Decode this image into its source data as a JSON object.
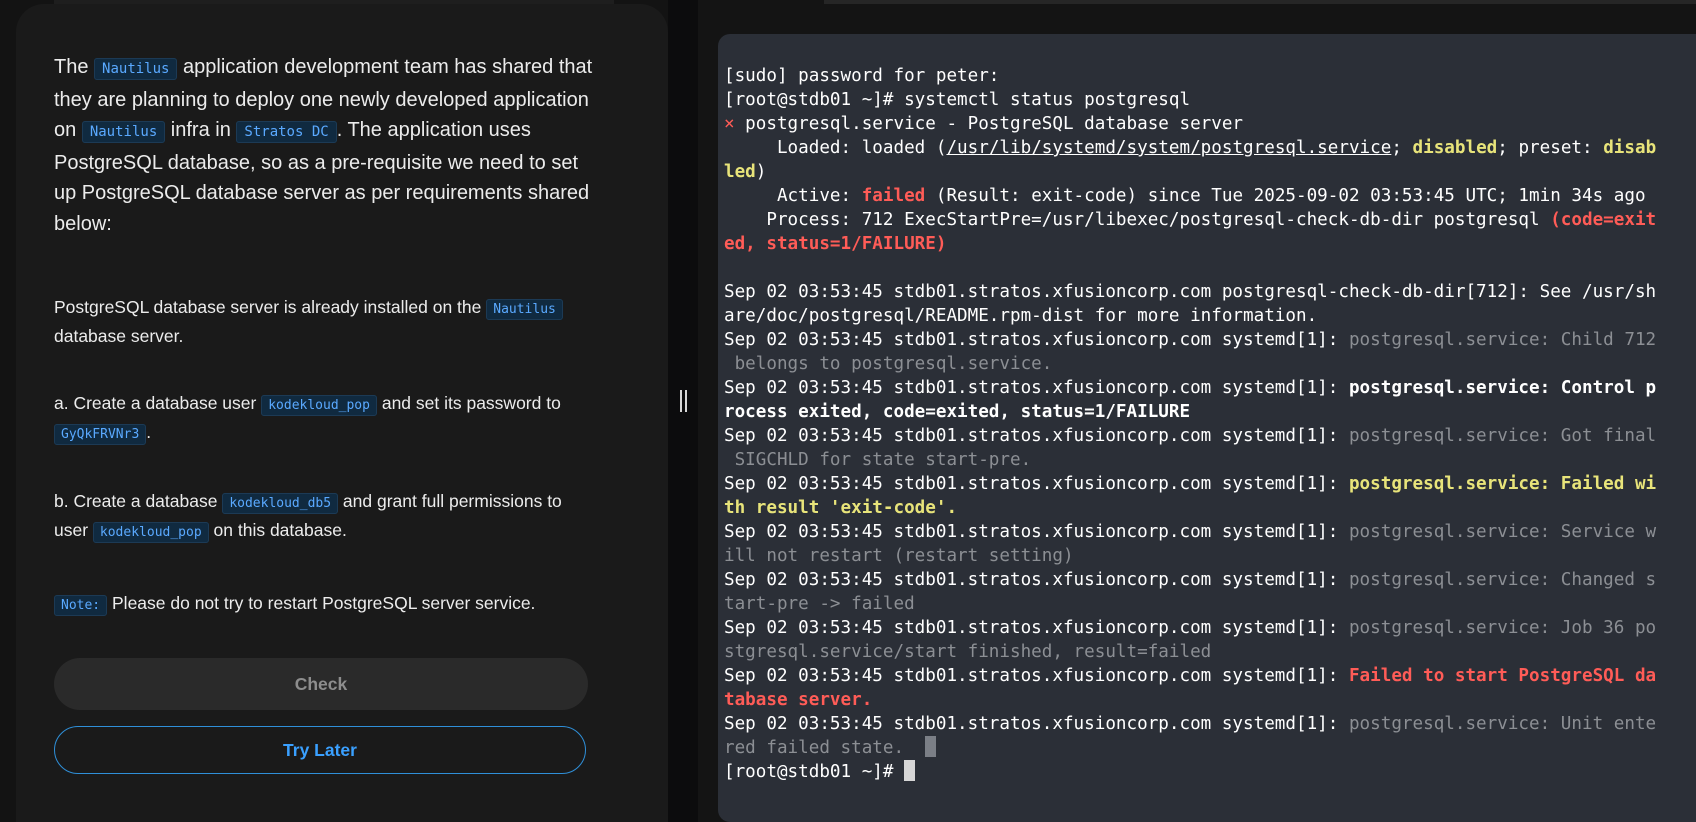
{
  "task": {
    "intro_1": "The ",
    "intro_tag_1": "Nautilus",
    "intro_2": " application development team has shared that they are planning to deploy one newly developed application on ",
    "intro_tag_2": "Nautilus",
    "intro_3": " infra in ",
    "intro_tag_3": "Stratos DC",
    "intro_4": ". The application uses PostgreSQL database, so as a pre-requisite we need to set up PostgreSQL database server as per requirements shared below:",
    "p1_text": "PostgreSQL database server is already installed on the ",
    "p1_tag": "Nautilus",
    "p1_text2": " database server.",
    "pa_text": "a. Create a database user ",
    "pa_tag": "kodekloud_pop",
    "pa_text2": " and set its password to ",
    "pa_tag2": "GyQkFRVNr3",
    "pa_text3": ".",
    "pb_text": "b. Create a database ",
    "pb_tag": "kodekloud_db5",
    "pb_text2": " and grant full permissions to user ",
    "pb_tag2": "kodekloud_pop",
    "pb_text3": " on this database.",
    "note_tag": "Note:",
    "note_text": " Please do not try to restart PostgreSQL server service."
  },
  "buttons": {
    "check": "Check",
    "try_later": "Try Later"
  },
  "terminal": {
    "l01": "[sudo] password for peter:",
    "l02": "[root@stdb01 ~]# systemctl status postgresql",
    "l03_x": "×",
    "l03": " postgresql.service - PostgreSQL database server",
    "l04_a": "     Loaded: loaded (",
    "l04_path": "/usr/lib/systemd/system/postgresql.service",
    "l04_b": "; ",
    "l04_dis": "disabled",
    "l04_c": "; preset: ",
    "l04_dis2": "disab",
    "l05_dis": "led",
    "l05": ")",
    "l06_a": "     Active: ",
    "l06_failed": "failed",
    "l06_b": " (Result: exit-code) since Tue 2025-09-02 03:53:45 UTC; 1min 34s ago",
    "l07_a": "    Process: 712 ExecStartPre=/usr/libexec/postgresql-check-db-dir postgresql ",
    "l07_red": "(code=exit",
    "l08_red": "ed, status=1/FAILURE)",
    "l10": "Sep 02 03:53:45 stdb01.stratos.xfusioncorp.com postgresql-check-db-dir[712]: See /usr/sh",
    "l11": "are/doc/postgresql/README.rpm-dist for more information.",
    "prefix": "Sep 02 03:53:45 stdb01.stratos.xfusioncorp.com systemd[1]: ",
    "l12": "postgresql.service: Child 712",
    "l13": " belongs to postgresql.service.",
    "l14": "postgresql.service: Control p",
    "l15": "rocess exited, code=exited, status=1/FAILURE",
    "l16": "postgresql.service: Got final",
    "l17": " SIGCHLD for state start-pre.",
    "l18": "postgresql.service: Failed wi",
    "l19": "th result 'exit-code'.",
    "l20": "postgresql.service: Service w",
    "l21": "ill not restart (restart setting)",
    "l22": "postgresql.service: Changed s",
    "l23": "tart-pre -> failed",
    "l24": "postgresql.service: Job 36 po",
    "l25": "stgresql.service/start finished, result=failed",
    "l26": "Failed to start PostgreSQL da",
    "l27": "tabase server.",
    "l28": "postgresql.service: Unit ente",
    "l29": "red failed state.",
    "prompt": "[root@stdb01 ~]# "
  },
  "colors": {
    "accent": "#3aa0ff",
    "terminal_bg": "#2b2f37",
    "error_red": "#ff5c57",
    "warn_yellow": "#e8e47a"
  }
}
